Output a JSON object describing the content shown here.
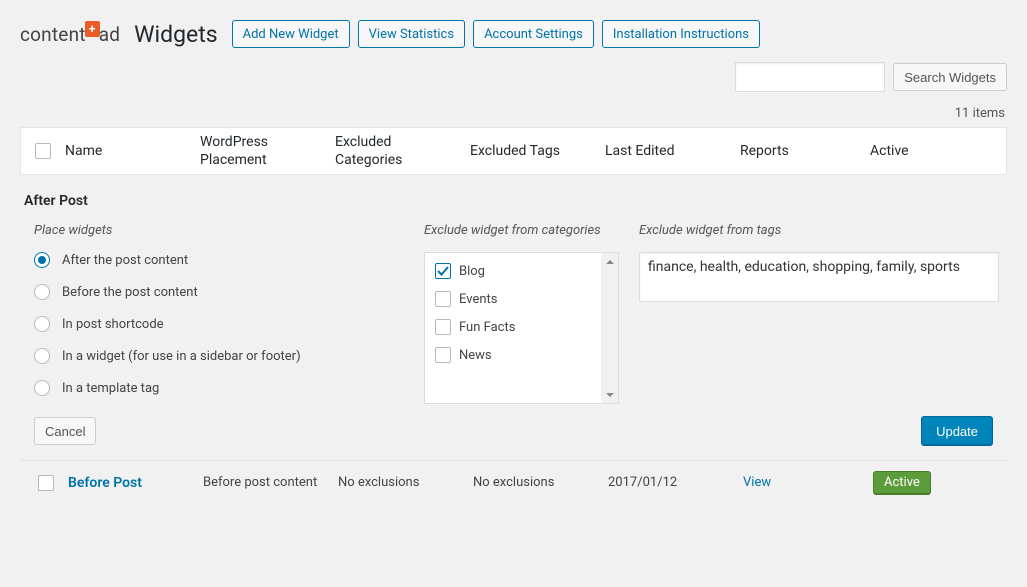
{
  "logo": {
    "prefix": "content",
    "badge": "+",
    "suffix": "ad"
  },
  "page_title": "Widgets",
  "header_buttons": {
    "add": "Add New Widget",
    "stats": "View Statistics",
    "account": "Account Settings",
    "install": "Installation Instructions"
  },
  "search": {
    "placeholder": "",
    "button": "Search Widgets",
    "value": ""
  },
  "count_text": "11 items",
  "columns": {
    "name": "Name",
    "placement_l1": "WordPress",
    "placement_l2": "Placement",
    "excat_l1": "Excluded",
    "excat_l2": "Categories",
    "extags": "Excluded Tags",
    "edited": "Last Edited",
    "reports": "Reports",
    "active": "Active"
  },
  "expanded": {
    "title": "After Post",
    "place_label": "Place widgets",
    "placement_options": [
      {
        "label": "After the post content",
        "checked": true
      },
      {
        "label": "Before the post content",
        "checked": false
      },
      {
        "label": "In post shortcode",
        "checked": false
      },
      {
        "label": "In a widget (for use in a sidebar or footer)",
        "checked": false
      },
      {
        "label": "In a template tag",
        "checked": false
      }
    ],
    "cat_label": "Exclude widget from categories",
    "categories": [
      {
        "label": "Blog",
        "checked": true
      },
      {
        "label": "Events",
        "checked": false
      },
      {
        "label": "Fun Facts",
        "checked": false
      },
      {
        "label": "News",
        "checked": false
      }
    ],
    "tags_label": "Exclude widget from tags",
    "tags_value": "finance, health, education, shopping, family, sports",
    "cancel": "Cancel",
    "update": "Update"
  },
  "row": {
    "name": "Before Post",
    "placement": "Before post content",
    "excat": "No exclusions",
    "extags": "No exclusions",
    "edited": "2017/01/12",
    "view": "View",
    "active": "Active"
  }
}
